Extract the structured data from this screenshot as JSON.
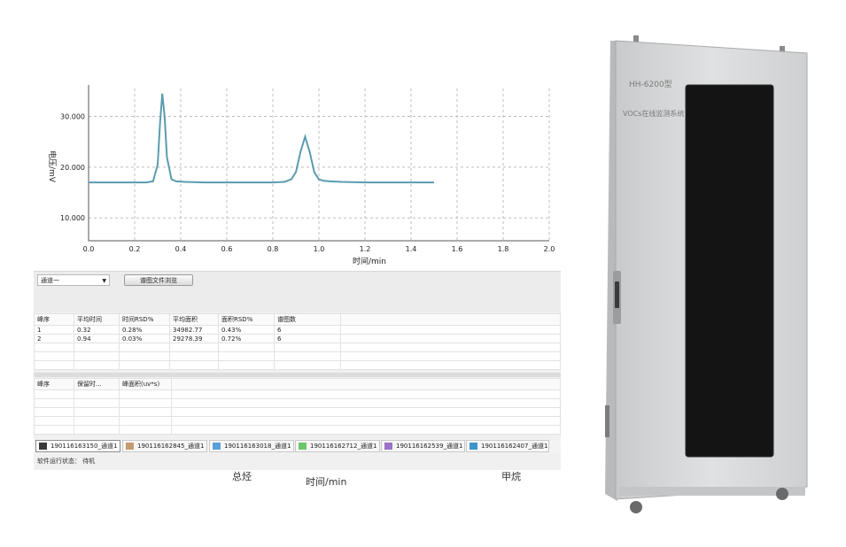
{
  "chart_data": {
    "type": "line",
    "xlabel": "时间/min",
    "ylabel": "电压/mV",
    "xlim": [
      0.0,
      2.0
    ],
    "ylim": [
      5.5,
      35.5
    ],
    "xticks": [
      "0.0",
      "0.2",
      "0.4",
      "0.6",
      "0.8",
      "1.0",
      "1.2",
      "1.4",
      "1.6",
      "1.8",
      "2.0"
    ],
    "yticks": [
      "10.000",
      "20.000",
      "30.000"
    ],
    "ytick_values": [
      10,
      20,
      30
    ],
    "grid": true,
    "series": [
      {
        "color": "#5b9bb0",
        "x": [
          0.0,
          0.05,
          0.1,
          0.15,
          0.2,
          0.25,
          0.28,
          0.3,
          0.31,
          0.32,
          0.33,
          0.34,
          0.36,
          0.38,
          0.42,
          0.5,
          0.6,
          0.7,
          0.8,
          0.85,
          0.88,
          0.9,
          0.92,
          0.94,
          0.96,
          0.98,
          1.0,
          1.02,
          1.05,
          1.1,
          1.2,
          1.3,
          1.4,
          1.5
        ],
        "y": [
          17.0,
          17.0,
          17.0,
          17.0,
          17.0,
          17.0,
          17.2,
          20.5,
          28.5,
          34.5,
          30.0,
          22.0,
          17.6,
          17.2,
          17.1,
          17.0,
          17.0,
          17.0,
          17.0,
          17.1,
          17.6,
          19.0,
          23.0,
          26.0,
          23.0,
          19.0,
          17.6,
          17.3,
          17.2,
          17.1,
          17.0,
          17.0,
          17.0,
          17.0
        ]
      }
    ]
  },
  "controls": {
    "channel_select": "通道一",
    "browse_button": "谱图文件浏览"
  },
  "table1": {
    "headers": [
      "峰序",
      "平均时间",
      "时间RSD%",
      "平均面积",
      "面积RSD%",
      "谱图数"
    ],
    "rows": [
      [
        "1",
        "0.32",
        "0.28%",
        "34982.77",
        "0.43%",
        "6"
      ],
      [
        "2",
        "0.94",
        "0.03%",
        "29278.39",
        "0.72%",
        "6"
      ]
    ]
  },
  "table2": {
    "headers": [
      "峰序",
      "保留时...",
      "峰面积(uv*s)"
    ]
  },
  "tabs": [
    {
      "label": "190116163150_通道1",
      "color": "#3a3a3a"
    },
    {
      "label": "190116162845_通道1",
      "color": "#c69a72"
    },
    {
      "label": "190116163018_通道1",
      "color": "#5aa0d8"
    },
    {
      "label": "190116162712_通道1",
      "color": "#6cc56c"
    },
    {
      "label": "190116162539_通道1",
      "color": "#9a73c4"
    },
    {
      "label": "190116162407_通道1",
      "color": "#3d95c9"
    }
  ],
  "status": {
    "label": "软件运行状态：",
    "value": "待机"
  },
  "captions": {
    "left": "总烃",
    "center": "时间/min",
    "right": "甲烷"
  },
  "cabinet": {
    "model": "HH-6200型",
    "name": "VOCs在线监测系统",
    "body_color": "#d9dadb",
    "window_color": "#141414"
  }
}
